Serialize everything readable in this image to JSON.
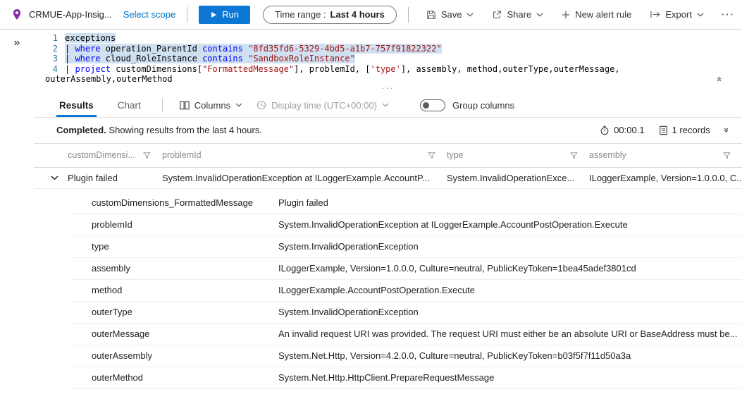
{
  "toolbar": {
    "app_name": "CRMUE-App-Insig...",
    "select_scope": "Select scope",
    "run": "Run",
    "time_range_label": "Time range :",
    "time_range_value": "Last 4 hours",
    "save": "Save",
    "share": "Share",
    "new_alert_rule": "New alert rule",
    "export": "Export",
    "more": "···"
  },
  "icons": {
    "double_chevron": "»",
    "handle": "···",
    "plus": "+"
  },
  "editor": {
    "lines": [
      {
        "num": "1",
        "hl": true,
        "tokens": [
          {
            "t": "exceptions",
            "c": "pl"
          }
        ]
      },
      {
        "num": "2",
        "hl": true,
        "tokens": [
          {
            "t": "| ",
            "c": "pl"
          },
          {
            "t": "where",
            "c": "kw"
          },
          {
            "t": " operation_ParentId ",
            "c": "pl"
          },
          {
            "t": "contains",
            "c": "kw"
          },
          {
            "t": " ",
            "c": "pl"
          },
          {
            "t": "\"8fd35fd6-5329-4bd5-a1b7-757f91822322\"",
            "c": "str"
          }
        ]
      },
      {
        "num": "3",
        "hl": true,
        "tokens": [
          {
            "t": "| ",
            "c": "pl"
          },
          {
            "t": "where",
            "c": "kw"
          },
          {
            "t": " cloud_RoleInstance ",
            "c": "pl"
          },
          {
            "t": "contains",
            "c": "kw"
          },
          {
            "t": " ",
            "c": "pl"
          },
          {
            "t": "\"SandboxRoleInstance\"",
            "c": "str"
          }
        ]
      },
      {
        "num": "4",
        "hl": false,
        "tokens": [
          {
            "t": "| ",
            "c": "pl"
          },
          {
            "t": "project",
            "c": "kw"
          },
          {
            "t": " customDimensions[",
            "c": "pl"
          },
          {
            "t": "\"FormattedMessage\"",
            "c": "str"
          },
          {
            "t": "], problemId, [",
            "c": "pl"
          },
          {
            "t": "'type'",
            "c": "str"
          },
          {
            "t": "], assembly, method,outerType,outerMessage,",
            "c": "pl"
          }
        ]
      },
      {
        "num": "",
        "wrap": true,
        "hl": false,
        "tokens": [
          {
            "t": "outerAssembly,outerMethod",
            "c": "pl"
          }
        ]
      }
    ]
  },
  "tabs": {
    "results": "Results",
    "chart": "Chart",
    "columns": "Columns",
    "display_time": "Display time (UTC+00:00)",
    "group_columns": "Group columns"
  },
  "status": {
    "completed": "Completed.",
    "rest": "Showing results from the last 4 hours.",
    "elapsed": "00:00.1",
    "records": "1 records"
  },
  "table": {
    "headers": [
      "customDimensi...",
      "problemId",
      "type",
      "assembly"
    ],
    "row": {
      "customDimensions": "Plugin failed",
      "problemId": "System.InvalidOperationException at ILoggerExample.AccountP...",
      "type": "System.InvalidOperationExce...",
      "assembly": "ILoggerExample, Version=1.0.0.0, C..."
    },
    "details": [
      {
        "key": "customDimensions_FormattedMessage",
        "value": "Plugin failed"
      },
      {
        "key": "problemId",
        "value": "System.InvalidOperationException at ILoggerExample.AccountPostOperation.Execute"
      },
      {
        "key": "type",
        "value": "System.InvalidOperationException"
      },
      {
        "key": "assembly",
        "value": "ILoggerExample, Version=1.0.0.0, Culture=neutral, PublicKeyToken=1bea45adef3801cd"
      },
      {
        "key": "method",
        "value": "ILoggerExample.AccountPostOperation.Execute"
      },
      {
        "key": "outerType",
        "value": "System.InvalidOperationException"
      },
      {
        "key": "outerMessage",
        "value": "An invalid request URI was provided. The request URI must either be an absolute URI or BaseAddress must be..."
      },
      {
        "key": "outerAssembly",
        "value": "System.Net.Http, Version=4.2.0.0, Culture=neutral, PublicKeyToken=b03f5f7f11d50a3a"
      },
      {
        "key": "outerMethod",
        "value": "System.Net.Http.HttpClient.PrepareRequestMessage"
      }
    ]
  },
  "colors": {
    "accent_blue": "#0c77d4",
    "keyword": "#0000ff",
    "string": "#a31515",
    "selection": "#cfe0f1",
    "app_purple": "#8a2da5"
  }
}
